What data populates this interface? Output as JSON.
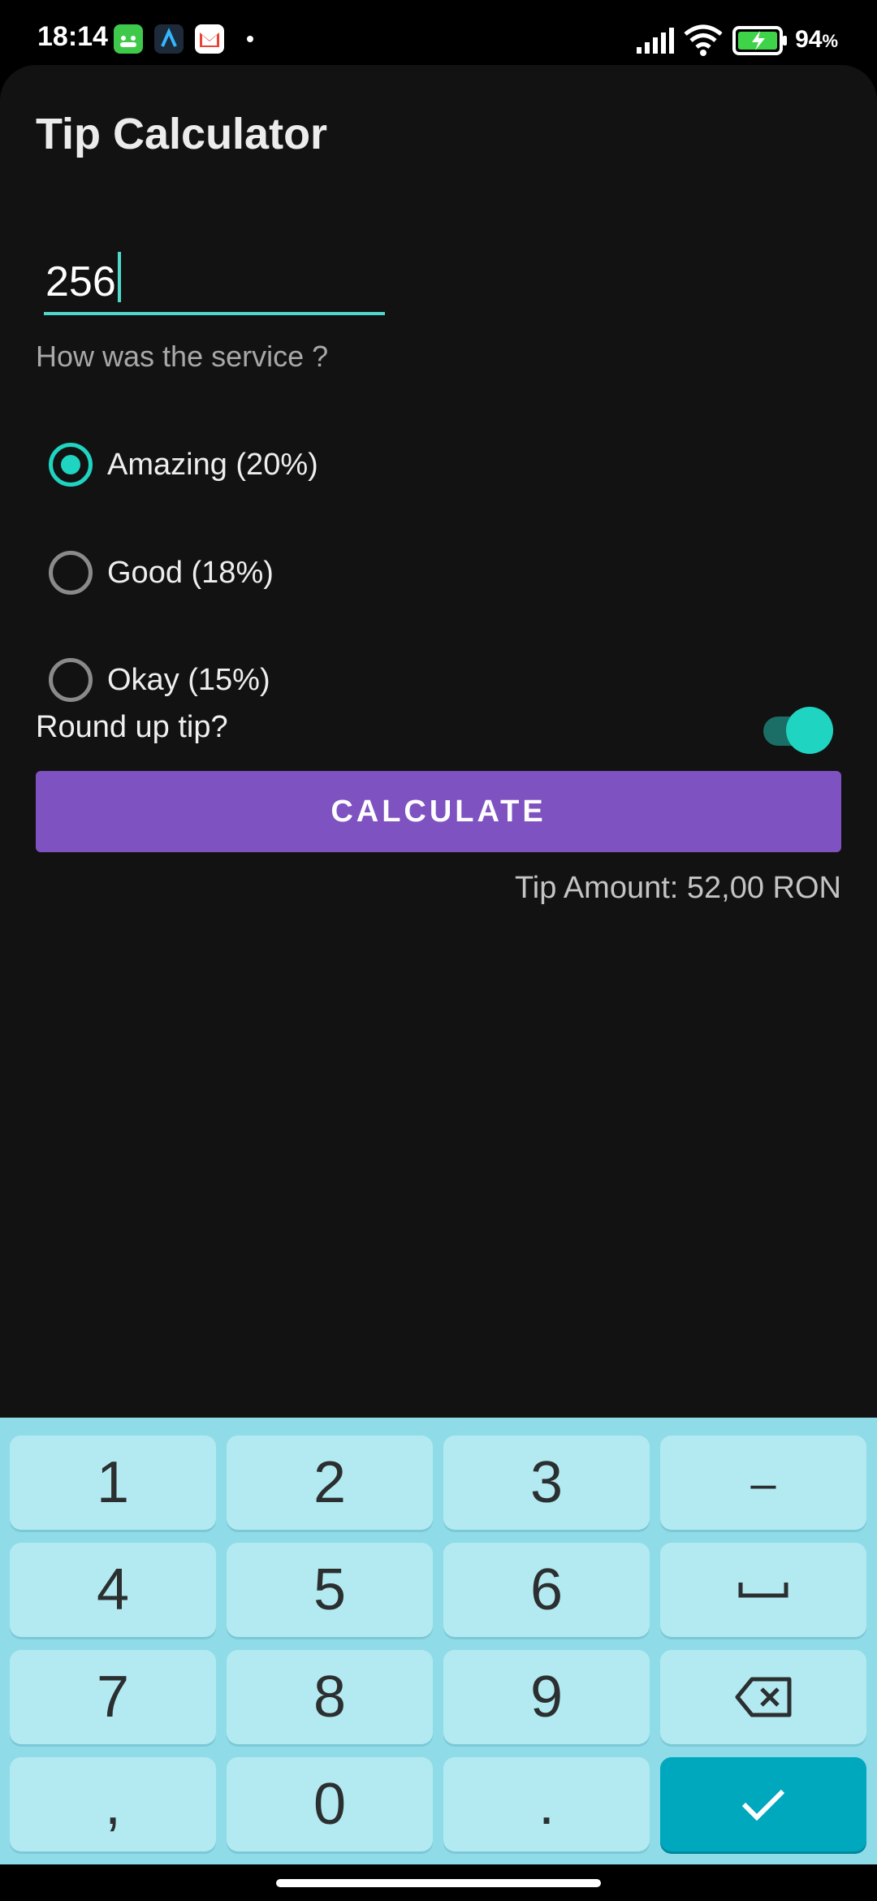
{
  "status_bar": {
    "time": "18:14",
    "battery": "94",
    "battery_unit": "%"
  },
  "app": {
    "title": "Tip Calculator",
    "bill_value": "256",
    "question": "How was the service ?",
    "options": [
      {
        "label": "Amazing (20%)",
        "checked": true
      },
      {
        "label": "Good (18%)",
        "checked": false
      },
      {
        "label": "Okay (15%)",
        "checked": false
      }
    ],
    "round_label": "Round up tip?",
    "round_enabled": true,
    "calculate_label": "CALCULATE",
    "tip_result": "Tip Amount: 52,00 RON"
  },
  "keyboard": {
    "keys": [
      "1",
      "2",
      "3",
      "–",
      "4",
      "5",
      "6",
      "␣",
      "7",
      "8",
      "9",
      "⌫",
      ",",
      "0",
      ".",
      "✓"
    ]
  },
  "colors": {
    "accent": "#1fd4c0",
    "button": "#7f52c1",
    "background": "#121212",
    "keyboard": "#8fdce8"
  }
}
